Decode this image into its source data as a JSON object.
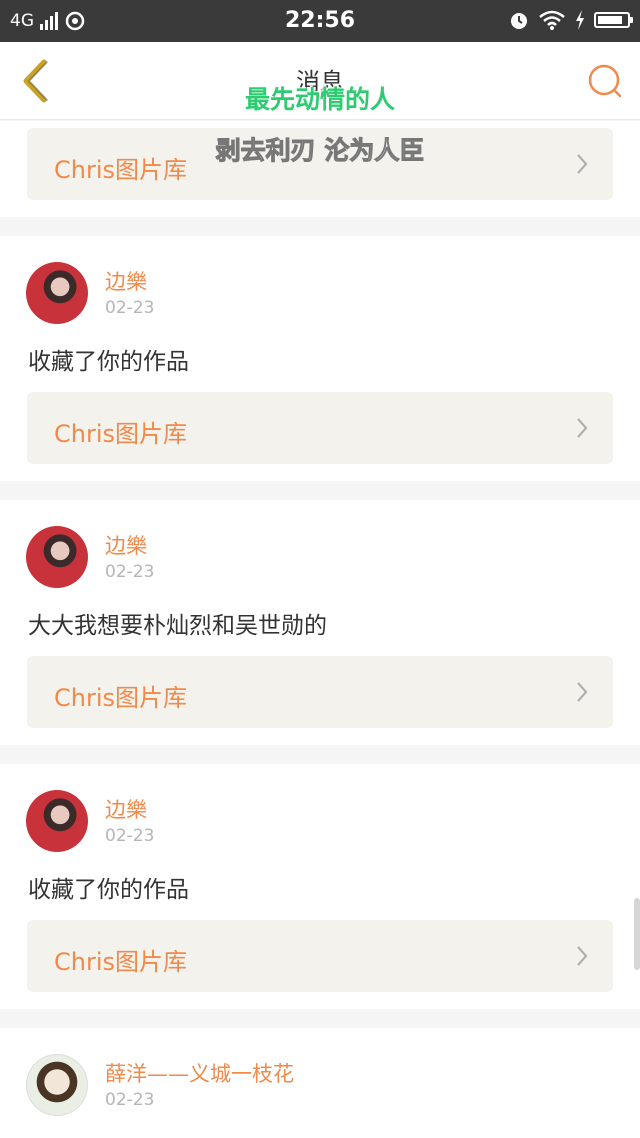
{
  "status_bar": {
    "network": "4G",
    "time": "22:56",
    "battery_level": 0.85
  },
  "header": {
    "title": "消息",
    "back_icon": "chevron-left-icon",
    "search_icon": "search-icon"
  },
  "overlay": {
    "lyric_line1": "最先动情的人",
    "lyric_line2": "剥去利刃 沦为人臣"
  },
  "colors": {
    "accent": "#f08a4b",
    "link_bg": "#f3f2ec",
    "date": "#b5b5b5",
    "lyric_green": "#2ecc71"
  },
  "messages": [
    {
      "link_label": "Chris图片库"
    },
    {
      "name": "边樂",
      "date": "02-23",
      "content": "收藏了你的作品",
      "link_label": "Chris图片库"
    },
    {
      "name": "边樂",
      "date": "02-23",
      "content": "大大我想要朴灿烈和吴世勋的",
      "link_label": "Chris图片库"
    },
    {
      "name": "边樂",
      "date": "02-23",
      "content": "收藏了你的作品",
      "link_label": "Chris图片库"
    },
    {
      "name": "薛洋——义城一枝花",
      "date": "02-23"
    }
  ]
}
